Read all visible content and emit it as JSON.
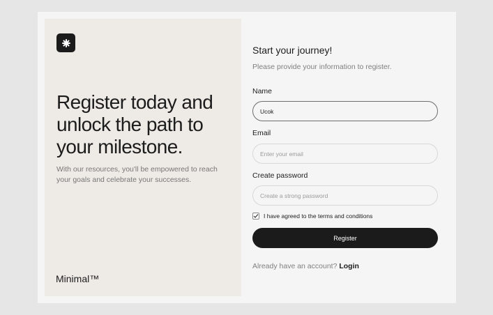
{
  "hero": {
    "headline": "Register today and unlock the path to your milestone.",
    "subtext": "With our resources, you'll be empowered to reach your goals and celebrate your successes.",
    "brand": "Minimal™",
    "logo_icon": "asterisk-icon"
  },
  "form": {
    "title": "Start your journey!",
    "subtitle": "Please provide your information to register.",
    "name": {
      "label": "Name",
      "value": "Ucok"
    },
    "email": {
      "label": "Email",
      "placeholder": "Enter your email"
    },
    "password": {
      "label": "Create password",
      "placeholder": "Create a strong password"
    },
    "terms": {
      "label": "I have agreed to the terms and conditions",
      "checked": true
    },
    "register_label": "Register",
    "login_prompt": "Already have an account?",
    "login_label": "Login"
  },
  "colors": {
    "background": "#e6e6e6",
    "card": "#f5f5f5",
    "hero_panel": "#eeebe6",
    "primary": "#1b1b1b"
  }
}
